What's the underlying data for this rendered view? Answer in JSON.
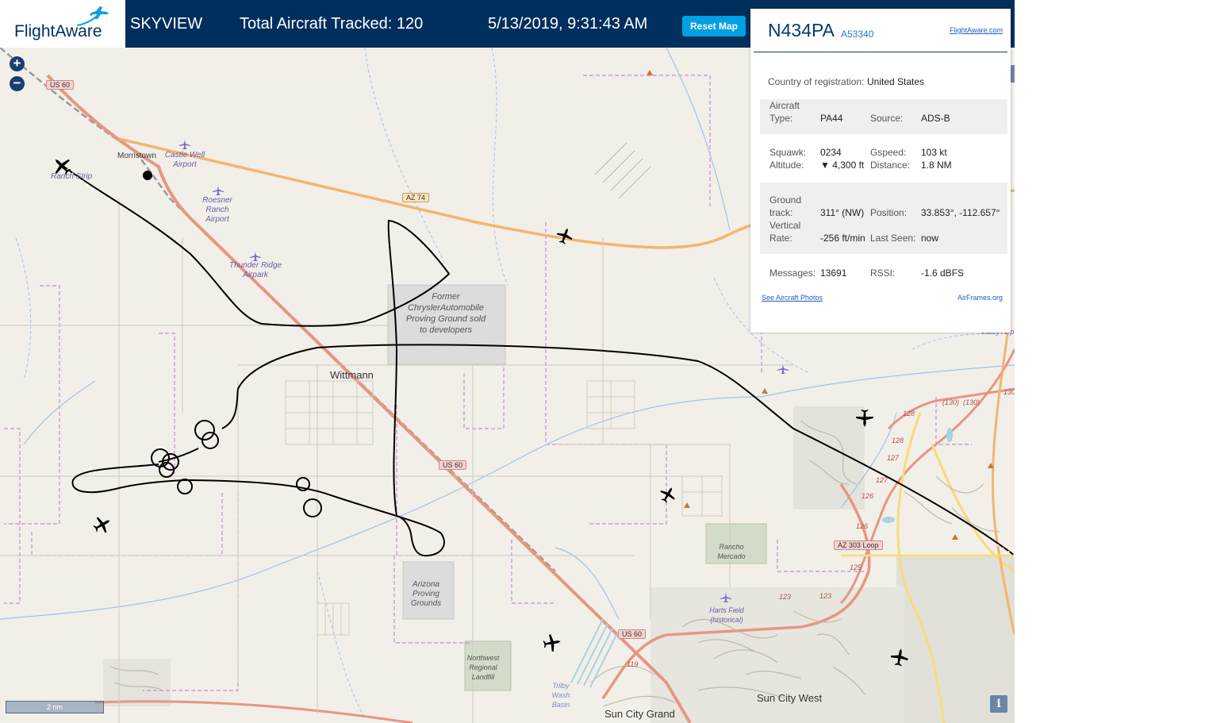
{
  "header": {
    "logo_text": "FlightAware",
    "app_name": "SKYVIEW",
    "aircraft_tracked_label": "Total Aircraft Tracked: 120",
    "datetime": "5/13/2019, 9:31:43 AM",
    "reset_button": "Reset Map"
  },
  "zoom": {
    "in": "+",
    "out": "−"
  },
  "info_panel": {
    "registration": "N434PA",
    "hex": "A53340",
    "flightaware_link": "FlightAware.com",
    "country_label": "Country of registration:",
    "country_value": "United States",
    "aircraft_type_label": "Aircraft Type:",
    "aircraft_type_value": "PA44",
    "source_label": "Source:",
    "source_value": "ADS-B",
    "squawk_label": "Squawk:",
    "squawk_value": "0234",
    "gspeed_label": "Gspeed:",
    "gspeed_value": "103 kt",
    "altitude_label": "Altitude:",
    "altitude_value": "▼ 4,300 ft",
    "distance_label": "Distance:",
    "distance_value": "1.8 NM",
    "ground_track_label": "Ground track:",
    "ground_track_value": "311° (NW)",
    "position_label": "Position:",
    "position_value": "33.853°, -112.657°",
    "vertical_rate_label": "Vertical Rate:",
    "vertical_rate_value": "-256 ft/min",
    "last_seen_label": "Last Seen:",
    "last_seen_value": "now",
    "messages_label": "Messages:",
    "messages_value": "13691",
    "rssi_label": "RSSI:",
    "rssi_value": "-1.6 dBFS",
    "photos_link": "See Aircraft Photos",
    "airframes_link": "AirFrames.org"
  },
  "map_labels": {
    "morristown": "Morristown",
    "castle_well": "Castle Well Airport",
    "roesner": "Roesner Ranch Airport",
    "thunder_ridge": "Thunder Ridge Airpark",
    "ranch_strip": "Ranch Strip",
    "chrysler": "Former ChryslerAutomobile Proving Ground sold to developers",
    "wittmann": "Wittmann",
    "arizona_proving": "Arizona Proving Grounds",
    "landfill": "Northwest Regional Landfill",
    "trilby": "Trilby Wash Basin",
    "rancho_mercado": "Rancho Mercado",
    "harts_field": "Harts Field (historical)",
    "sun_city_west": "Sun City West",
    "sun_city_grand": "Sun City Grand",
    "valley_airpark": "Valley Airp"
  },
  "highways": {
    "us60_a": "US 60",
    "us60_b": "US 60",
    "us60_c": "US 60",
    "az74": "AZ 74",
    "az303": "AZ 303 Loop"
  },
  "road_numbers": [
    "128",
    "128",
    "127",
    "127",
    "126",
    "126",
    "125",
    "123",
    "123",
    "119",
    "(130)",
    "(130)",
    "130"
  ],
  "scale": {
    "label": "2 nm"
  },
  "colors": {
    "header_bg": "#002f5d",
    "accent": "#00a0e2",
    "track": "#000000"
  },
  "icons": [
    "plane-icon",
    "zoom-in-icon",
    "zoom-out-icon",
    "info-icon",
    "airport-icon"
  ]
}
